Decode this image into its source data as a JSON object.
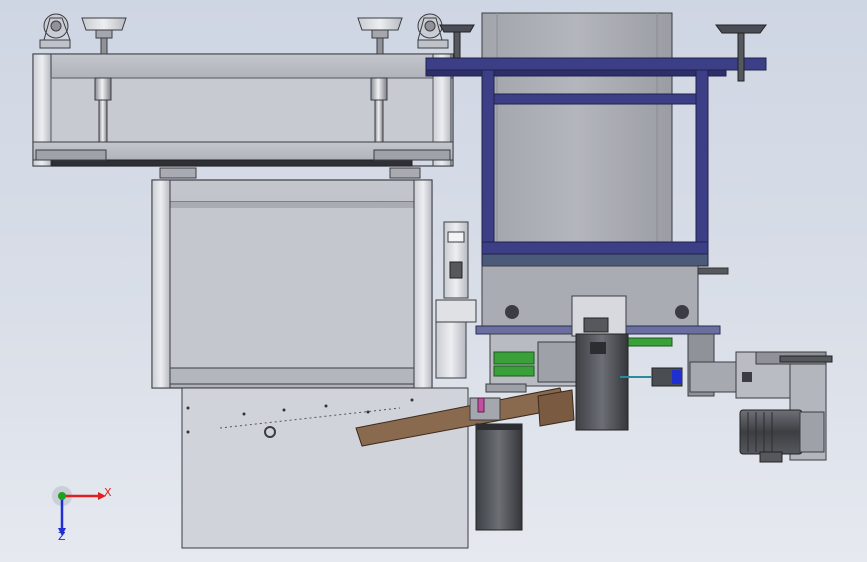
{
  "viewport": {
    "background_top": "#cfd6e3",
    "background_bottom": "#e6e9ef"
  },
  "colors": {
    "steel_light": "#d4d6db",
    "steel_mid": "#b9bcc3",
    "steel_dark": "#5d6068",
    "outline": "#3b3d42",
    "navy_frame": "#3c3f86",
    "wood": "#8a6a4e",
    "green_part": "#3aa13a",
    "motor_dark": "#4a4d52",
    "axis_x": "#e02020",
    "axis_y": "#20a020",
    "axis_z": "#2030d0"
  },
  "triad": {
    "x_label": "X",
    "z_label": "Z"
  }
}
